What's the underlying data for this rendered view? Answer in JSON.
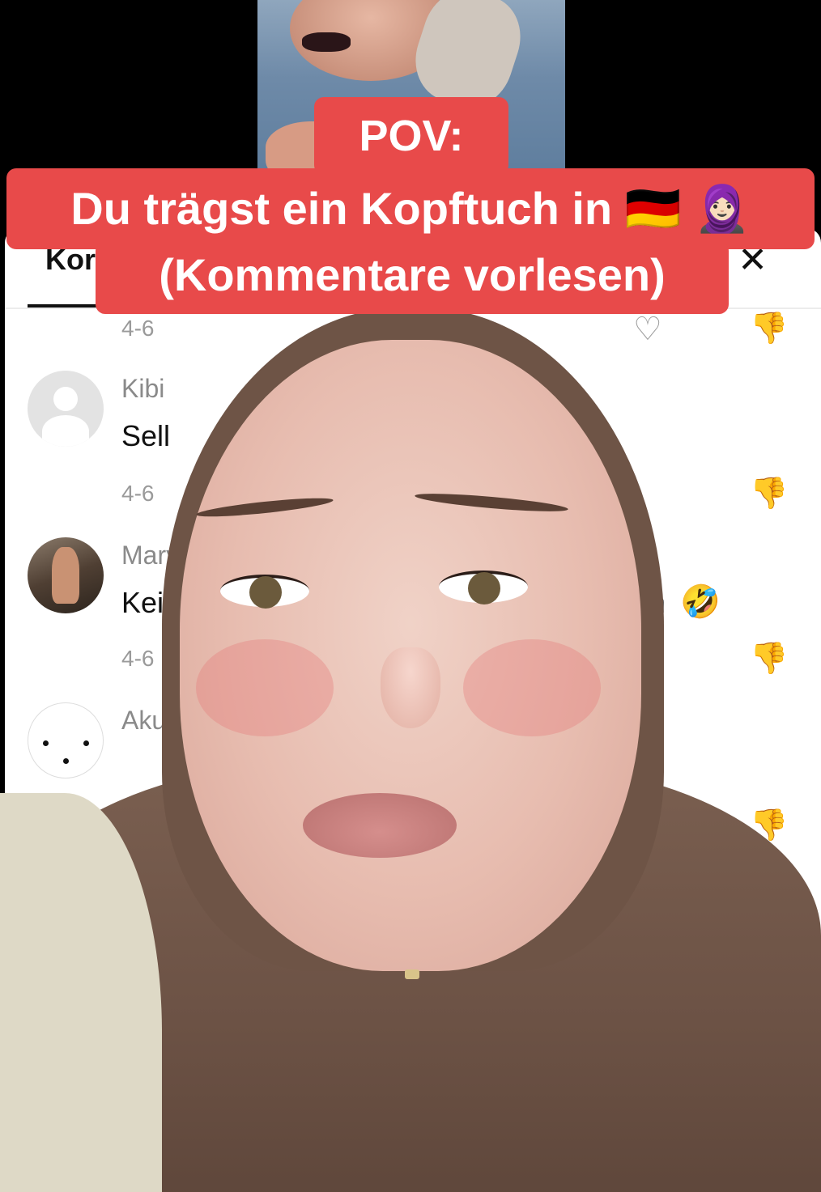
{
  "caption": {
    "line1": "POV:",
    "line2": "Du trägst ein Kopftuch in 🇩🇪 🧕🏻",
    "line3": "(Kommentare vorlesen)"
  },
  "sheet": {
    "tab_label": "Kor",
    "close_glyph": "✕"
  },
  "comments": [
    {
      "username": "",
      "text": "",
      "meta": "4-6"
    },
    {
      "username": "Kibi",
      "text": "Sell",
      "meta": "4-6"
    },
    {
      "username": "Mary",
      "text": "Kein",
      "tail": "n",
      "emoji": "🤣",
      "meta": "4-6"
    },
    {
      "username": "Akun",
      "text": "",
      "meta": ""
    }
  ],
  "icons": {
    "like": "♡",
    "dislike": "👎"
  },
  "colors": {
    "caption_bg": "#e84a4a",
    "sheet_bg": "#ffffff",
    "scarf": "#6e5446"
  }
}
